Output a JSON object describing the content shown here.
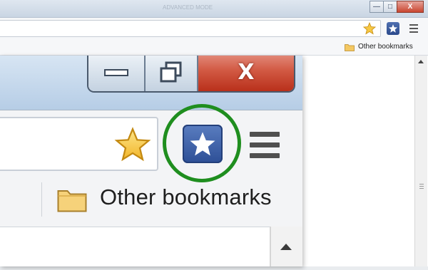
{
  "background_window": {
    "tab_ghost_text": "ADVANCED MODE",
    "window_buttons": {
      "minimize": "—",
      "maximize": "□",
      "close": "X"
    },
    "bookmarks_bar": {
      "folder_label": "Other bookmarks"
    },
    "icons": [
      "star-icon",
      "extension-star-icon",
      "menu-icon",
      "folder-icon"
    ]
  },
  "zoomed_window": {
    "window_buttons": {
      "minimize": "—",
      "maximize": "□",
      "close": "X"
    },
    "bookmarks_bar": {
      "folder_label": "Other bookmarks"
    },
    "highlight_color": "#1f8e1f",
    "extension_color": "#2d4f96",
    "icons": [
      "star-icon",
      "extension-star-icon",
      "menu-icon",
      "folder-icon",
      "scroll-up-arrow-icon"
    ]
  }
}
